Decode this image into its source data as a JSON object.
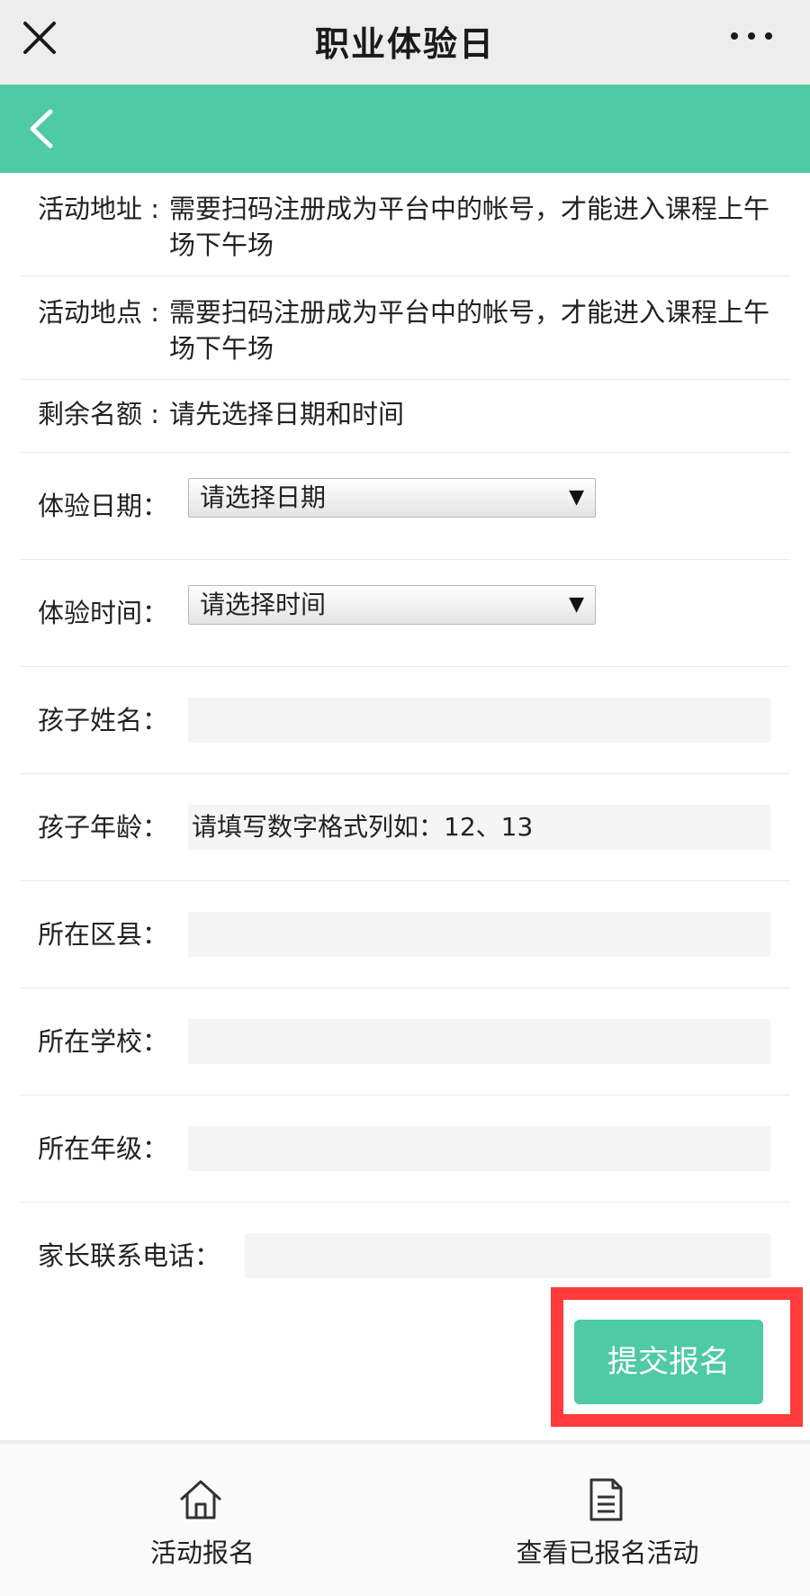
{
  "topbar": {
    "title": "职业体验日",
    "close_icon": "close-icon",
    "more_icon": "more-icon"
  },
  "nav": {
    "back_icon": "back-arrow-icon"
  },
  "info": [
    {
      "label": "活动地址 :",
      "value": "需要扫码注册成为平台中的帐号，才能进入课程上午场下午场"
    },
    {
      "label": "活动地点 :",
      "value": "需要扫码注册成为平台中的帐号，才能进入课程上午场下午场"
    },
    {
      "label": "剩余名额 :",
      "value": "请先选择日期和时间"
    }
  ],
  "form": {
    "date": {
      "label": "体验日期：",
      "value": "请选择日期"
    },
    "time": {
      "label": "体验时间：",
      "value": "请选择时间"
    },
    "child_name": {
      "label": "孩子姓名：",
      "value": ""
    },
    "child_age": {
      "label": "孩子年龄：",
      "placeholder": "请填写数字格式列如：12、13"
    },
    "district": {
      "label": "所在区县：",
      "value": ""
    },
    "school": {
      "label": "所在学校：",
      "value": ""
    },
    "grade": {
      "label": "所在年级：",
      "value": ""
    },
    "phone": {
      "label": "家长联系电话：",
      "value": ""
    }
  },
  "submit_label": "提交报名",
  "tabs": [
    {
      "label": "活动报名",
      "icon": "home-icon"
    },
    {
      "label": "查看已报名活动",
      "icon": "document-icon"
    }
  ],
  "colors": {
    "accent": "#4ecaa4",
    "highlight": "#ff3b3b",
    "topbar": "#ededed"
  }
}
